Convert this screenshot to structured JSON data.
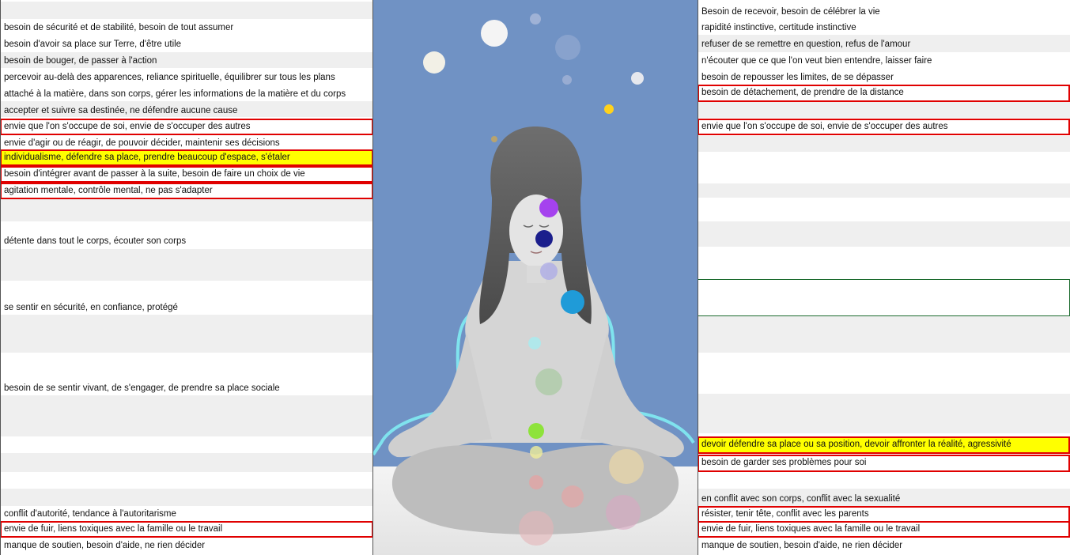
{
  "left_column": {
    "rows": [
      {
        "text": "besoin de sécurité et de stabilité, besoin de tout assumer",
        "style": "plain"
      },
      {
        "text": "besoin d'avoir sa place sur Terre, d'être utile",
        "style": "plain"
      },
      {
        "text": "besoin de bouger, de passer à l'action",
        "style": "plain"
      },
      {
        "text": "percevoir au-delà des apparences, reliance spirituelle, équilibrer sur tous les plans",
        "style": "plain"
      },
      {
        "text": "attaché à la matière, dans son corps, gérer les informations de la matière et du corps",
        "style": "plain"
      },
      {
        "text": "accepter et suivre sa destinée, ne défendre aucune cause",
        "style": "plain"
      },
      {
        "text": "envie que l'on s'occupe de soi, envie de s'occuper des autres",
        "style": "boxed"
      },
      {
        "text": "envie d'agir ou de réagir, de pouvoir décider, maintenir ses décisions",
        "style": "plain"
      },
      {
        "text": "individualisme, défendre sa place, prendre beaucoup d'espace, s'étaler",
        "style": "highlight"
      },
      {
        "text": "besoin d'intégrer avant de passer à la suite, besoin de faire un choix de vie",
        "style": "boxed"
      },
      {
        "text": "agitation mentale, contrôle mental, ne pas s'adapter",
        "style": "boxed"
      },
      {
        "text": "détente dans tout le corps, écouter son corps",
        "style": "plain"
      },
      {
        "text": "se sentir en sécurité, en confiance, protégé",
        "style": "plain"
      },
      {
        "text": "besoin de se sentir vivant, de s'engager, de prendre sa place sociale",
        "style": "plain"
      },
      {
        "text": "conflit d'autorité, tendance à l'autoritarisme",
        "style": "plain"
      },
      {
        "text": "envie de fuir, liens toxiques avec la famille ou le travail",
        "style": "boxed"
      },
      {
        "text": "manque de soutien, besoin d'aide, ne rien décider",
        "style": "plain"
      }
    ]
  },
  "right_column": {
    "rows": [
      {
        "text": "Besoin de recevoir, besoin de célébrer la vie",
        "style": "plain"
      },
      {
        "text": "rapidité instinctive, certitude instinctive",
        "style": "plain"
      },
      {
        "text": "refuser de se remettre en question, refus de l'amour",
        "style": "plain"
      },
      {
        "text": "n'écouter que ce que l'on veut bien entendre, laisser faire",
        "style": "plain"
      },
      {
        "text": "besoin de repousser les limites, de se dépasser",
        "style": "plain"
      },
      {
        "text": "besoin de détachement, de prendre de la distance",
        "style": "boxed"
      },
      {
        "text": "envie que l'on s'occupe de soi, envie de s'occuper des autres",
        "style": "boxed"
      },
      {
        "text": "devoir défendre sa place ou sa position, devoir affronter la réalité, agressivité",
        "style": "highlight"
      },
      {
        "text": "besoin de garder ses problèmes pour soi",
        "style": "boxed"
      },
      {
        "text": "en conflit avec son corps, conflit avec la sexualité",
        "style": "plain"
      },
      {
        "text": "résister, tenir tête, conflit avec les parents",
        "style": "boxed"
      },
      {
        "text": "envie de fuir, liens toxiques avec la famille ou le travail",
        "style": "boxed"
      },
      {
        "text": "manque de soutien, besoin d'aide, ne rien décider",
        "style": "plain"
      }
    ]
  },
  "colors": {
    "sky": "#7092c4",
    "box_border": "#e00000",
    "highlight": "#ffff00",
    "band": "#efefef",
    "figure_outline": "#7fe3ee"
  },
  "figure": {
    "icon": "meditating-woman-chakras-illustration"
  }
}
